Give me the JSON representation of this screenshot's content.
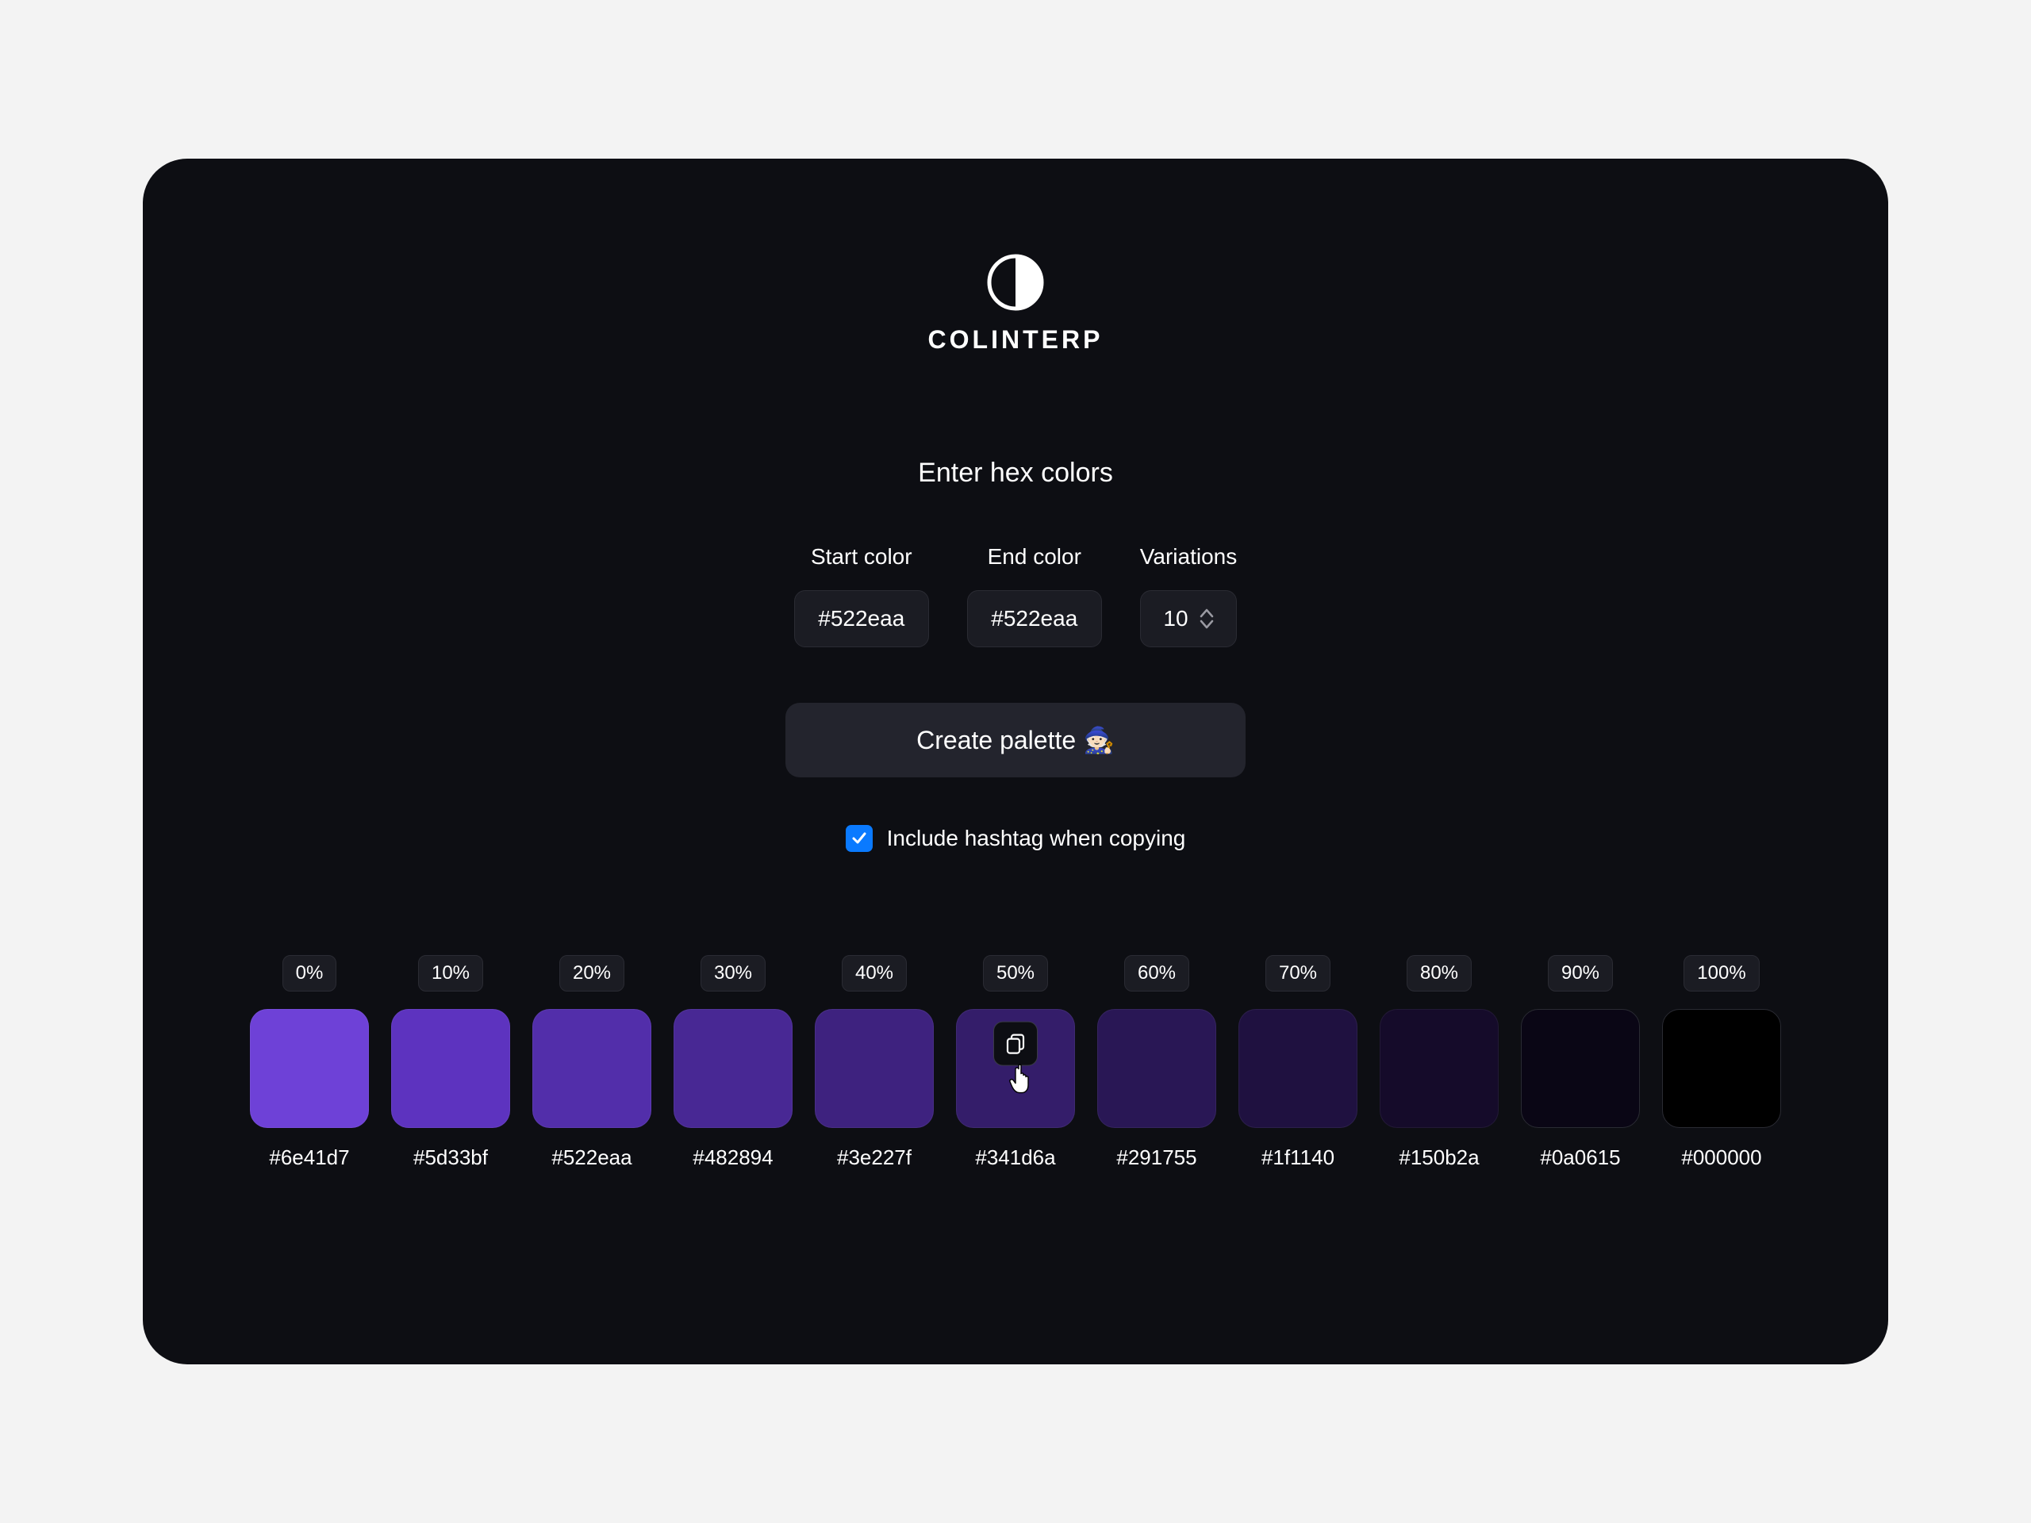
{
  "brand": {
    "name": "COLINTERP"
  },
  "heading": "Enter hex colors",
  "fields": {
    "start": {
      "label": "Start color",
      "value": "#522eaa"
    },
    "end": {
      "label": "End color",
      "value": "#522eaa"
    },
    "variations": {
      "label": "Variations",
      "value": "10"
    }
  },
  "create_button": "Create palette 🧙🏻",
  "checkbox": {
    "label": "Include hashtag when copying",
    "checked": true
  },
  "palette": [
    {
      "pct": "0%",
      "hex": "#6e41d7",
      "color": "#6e41d7"
    },
    {
      "pct": "10%",
      "hex": "#5d33bf",
      "color": "#5d33bf"
    },
    {
      "pct": "20%",
      "hex": "#522eaa",
      "color": "#522eaa"
    },
    {
      "pct": "30%",
      "hex": "#482894",
      "color": "#482894"
    },
    {
      "pct": "40%",
      "hex": "#3e227f",
      "color": "#3e227f"
    },
    {
      "pct": "50%",
      "hex": "#341d6a",
      "color": "#341d6a",
      "hover": true
    },
    {
      "pct": "60%",
      "hex": "#291755",
      "color": "#291755"
    },
    {
      "pct": "70%",
      "hex": "#1f1140",
      "color": "#1f1140"
    },
    {
      "pct": "80%",
      "hex": "#150b2a",
      "color": "#150b2a"
    },
    {
      "pct": "90%",
      "hex": "#0a0615",
      "color": "#0a0615"
    },
    {
      "pct": "100%",
      "hex": "#000000",
      "color": "#000000"
    }
  ]
}
